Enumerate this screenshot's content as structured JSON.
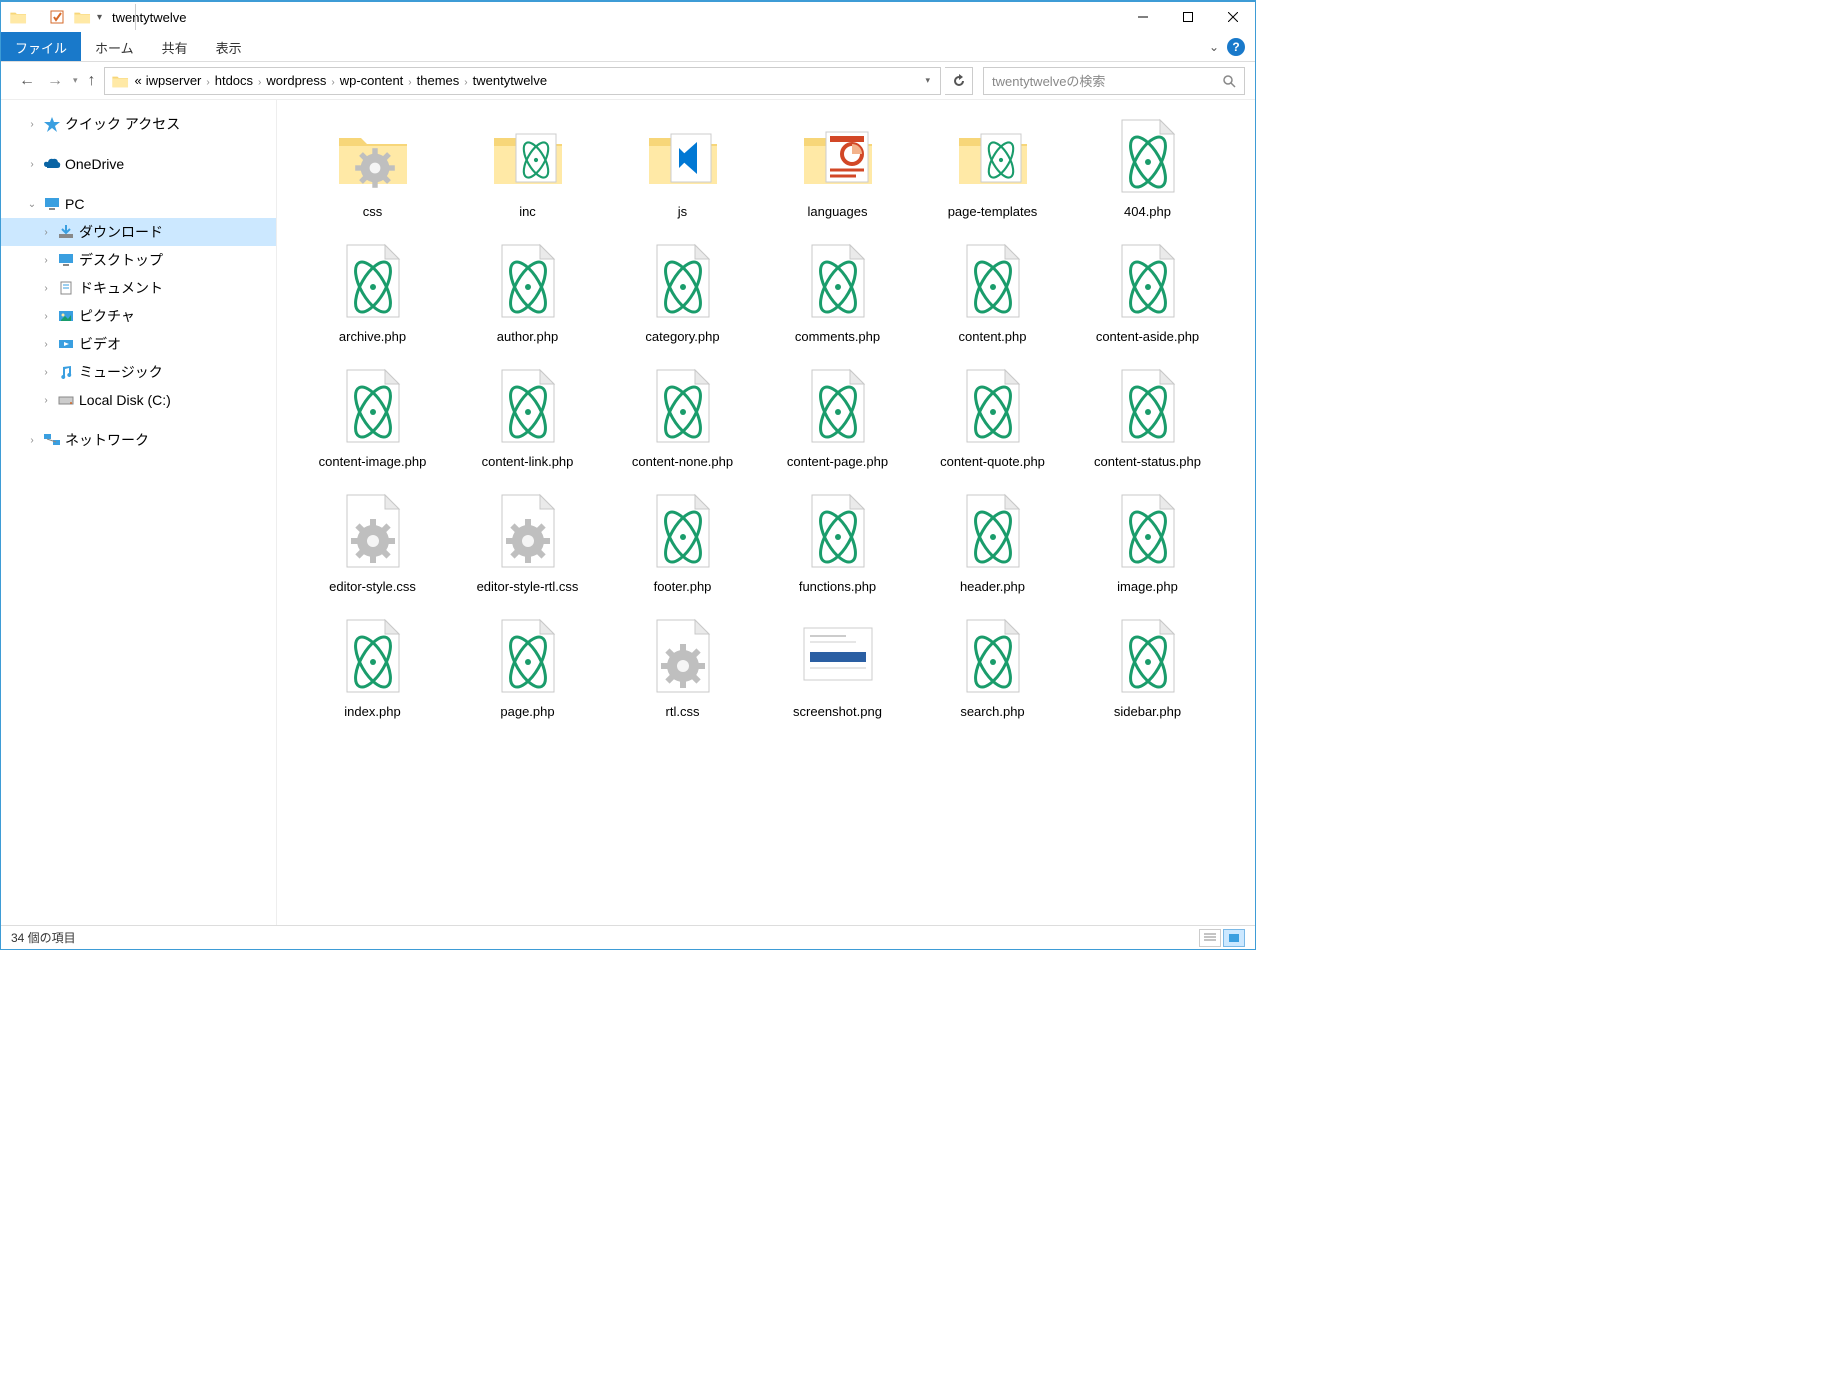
{
  "window": {
    "title": "twentytwelve"
  },
  "ribbon": {
    "file": "ファイル",
    "tabs": [
      "ホーム",
      "共有",
      "表示"
    ]
  },
  "breadcrumb": {
    "overflow": "«",
    "segments": [
      "iwpserver",
      "htdocs",
      "wordpress",
      "wp-content",
      "themes",
      "twentytwelve"
    ]
  },
  "search": {
    "placeholder": "twentytwelveの検索"
  },
  "tree": {
    "quick_access": "クイック アクセス",
    "onedrive": "OneDrive",
    "pc": "PC",
    "pc_children": [
      {
        "label": "ダウンロード",
        "selected": true
      },
      {
        "label": "デスクトップ"
      },
      {
        "label": "ドキュメント"
      },
      {
        "label": "ピクチャ"
      },
      {
        "label": "ビデオ"
      },
      {
        "label": "ミュージック"
      },
      {
        "label": "Local Disk (C:)"
      }
    ],
    "network": "ネットワーク"
  },
  "items": [
    {
      "name": "css",
      "kind": "folder-gear"
    },
    {
      "name": "inc",
      "kind": "folder-atom"
    },
    {
      "name": "js",
      "kind": "folder-vscode"
    },
    {
      "name": "languages",
      "kind": "folder-ppt"
    },
    {
      "name": "page-templates",
      "kind": "folder-atom"
    },
    {
      "name": "404.php",
      "kind": "atom"
    },
    {
      "name": "archive.php",
      "kind": "atom"
    },
    {
      "name": "author.php",
      "kind": "atom"
    },
    {
      "name": "category.php",
      "kind": "atom"
    },
    {
      "name": "comments.php",
      "kind": "atom"
    },
    {
      "name": "content.php",
      "kind": "atom"
    },
    {
      "name": "content-aside.php",
      "kind": "atom"
    },
    {
      "name": "content-image.php",
      "kind": "atom"
    },
    {
      "name": "content-link.php",
      "kind": "atom"
    },
    {
      "name": "content-none.php",
      "kind": "atom"
    },
    {
      "name": "content-page.php",
      "kind": "atom"
    },
    {
      "name": "content-quote.php",
      "kind": "atom"
    },
    {
      "name": "content-status.php",
      "kind": "atom"
    },
    {
      "name": "editor-style.css",
      "kind": "gear"
    },
    {
      "name": "editor-style-rtl.css",
      "kind": "gear"
    },
    {
      "name": "footer.php",
      "kind": "atom"
    },
    {
      "name": "functions.php",
      "kind": "atom"
    },
    {
      "name": "header.php",
      "kind": "atom"
    },
    {
      "name": "image.php",
      "kind": "atom"
    },
    {
      "name": "index.php",
      "kind": "atom"
    },
    {
      "name": "page.php",
      "kind": "atom"
    },
    {
      "name": "rtl.css",
      "kind": "gear"
    },
    {
      "name": "screenshot.png",
      "kind": "image"
    },
    {
      "name": "search.php",
      "kind": "atom"
    },
    {
      "name": "sidebar.php",
      "kind": "atom"
    }
  ],
  "status": {
    "text": "34 個の項目"
  }
}
